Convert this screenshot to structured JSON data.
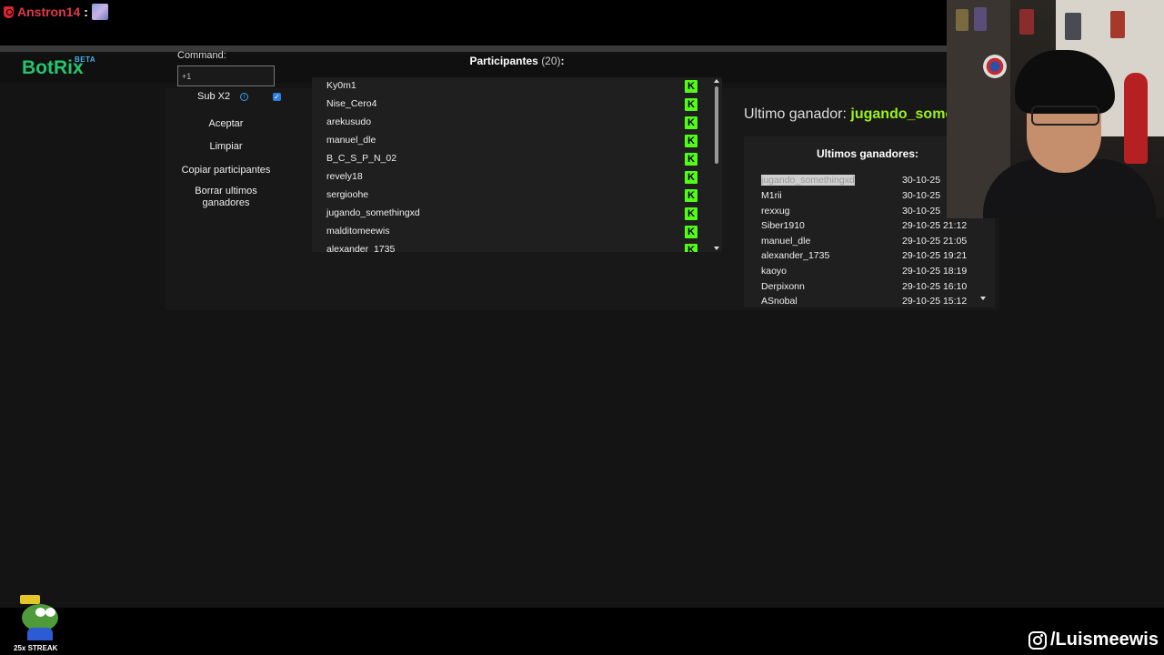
{
  "chat": {
    "user": "Anstron14",
    "separator": ":",
    "user_color": "#e0384a"
  },
  "app": {
    "logo": "BotRix",
    "logo_badge": "BETA",
    "accent": "#27c46e"
  },
  "controls": {
    "command_label": "Command:",
    "command_value": "+1",
    "sub_label": "Sub X2",
    "sub_checked": true,
    "buttons": [
      "Aceptar",
      "Limpiar",
      "Copiar participantes",
      "Borrar ultimos\nganadores"
    ]
  },
  "participants": {
    "title": "Participantes",
    "count": "(20)",
    "colon": ":",
    "icon": "kick-icon",
    "items": [
      "Ky0m1",
      "Nise_Cero4",
      "arekusudo",
      "manuel_dle",
      "B_C_S_P_N_02",
      "revely18",
      "sergioohe",
      "jugando_somethingxd",
      "malditomeewis",
      "alexander_1735"
    ]
  },
  "winner": {
    "label": "Ultimo ganador:",
    "name": "jugando_some",
    "color": "#9cf21b"
  },
  "winners": {
    "title": "Ultimos ganadores:",
    "rows": [
      {
        "name": "jugando_somethingxd",
        "date": "30-10-25"
      },
      {
        "name": "M1rii",
        "date": "30-10-25"
      },
      {
        "name": "rexxug",
        "date": "30-10-25"
      },
      {
        "name": "Siber1910",
        "date": "29-10-25 21:12"
      },
      {
        "name": "manuel_dle",
        "date": "29-10-25 21:05"
      },
      {
        "name": "alexander_1735",
        "date": "29-10-25 19:21"
      },
      {
        "name": "kaoyo",
        "date": "29-10-25 18:19"
      },
      {
        "name": "Derpixonn",
        "date": "29-10-25 16:10"
      },
      {
        "name": "ASnobal",
        "date": "29-10-25 15:12"
      }
    ]
  },
  "overlay": {
    "streak": "25x STREAK",
    "social_handle": "/Luismeewis"
  }
}
